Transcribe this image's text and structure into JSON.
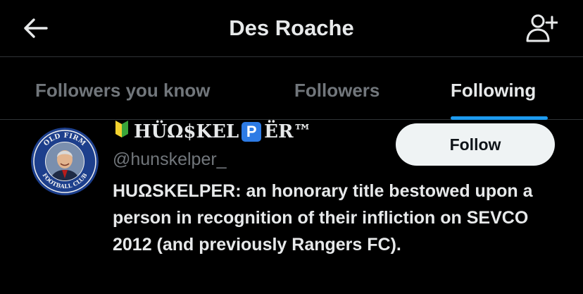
{
  "header": {
    "title": "Des Roache",
    "back_icon": "arrow-left-icon",
    "add_user_icon": "person-add-icon"
  },
  "tabs": [
    {
      "label": "Followers you know",
      "active": false
    },
    {
      "label": "Followers",
      "active": false
    },
    {
      "label": "Following",
      "active": true
    }
  ],
  "user": {
    "name_part1": "HÜΩ$KEL",
    "name_parking_glyph": "P",
    "name_part2": "ËR™",
    "name_prefix_icon": "japanese-beginner-symbol-icon",
    "handle": "@hunskelper_",
    "follow_label": "Follow",
    "bio": "HUΩSKELPER: an honorary title bestowed upon a person in recognition of their infliction on SEVCO 2012 (and previously Rangers FC).",
    "avatar": {
      "ring_text_top": "OLD FIRM",
      "ring_text_bottom": "FOOTBALL CLUB"
    }
  },
  "colors": {
    "background": "#000000",
    "text_primary": "#e7e9ea",
    "text_secondary": "#71767b",
    "accent": "#1d9bf0",
    "divider": "#2f3336",
    "follow_button_bg": "#eff3f4"
  }
}
